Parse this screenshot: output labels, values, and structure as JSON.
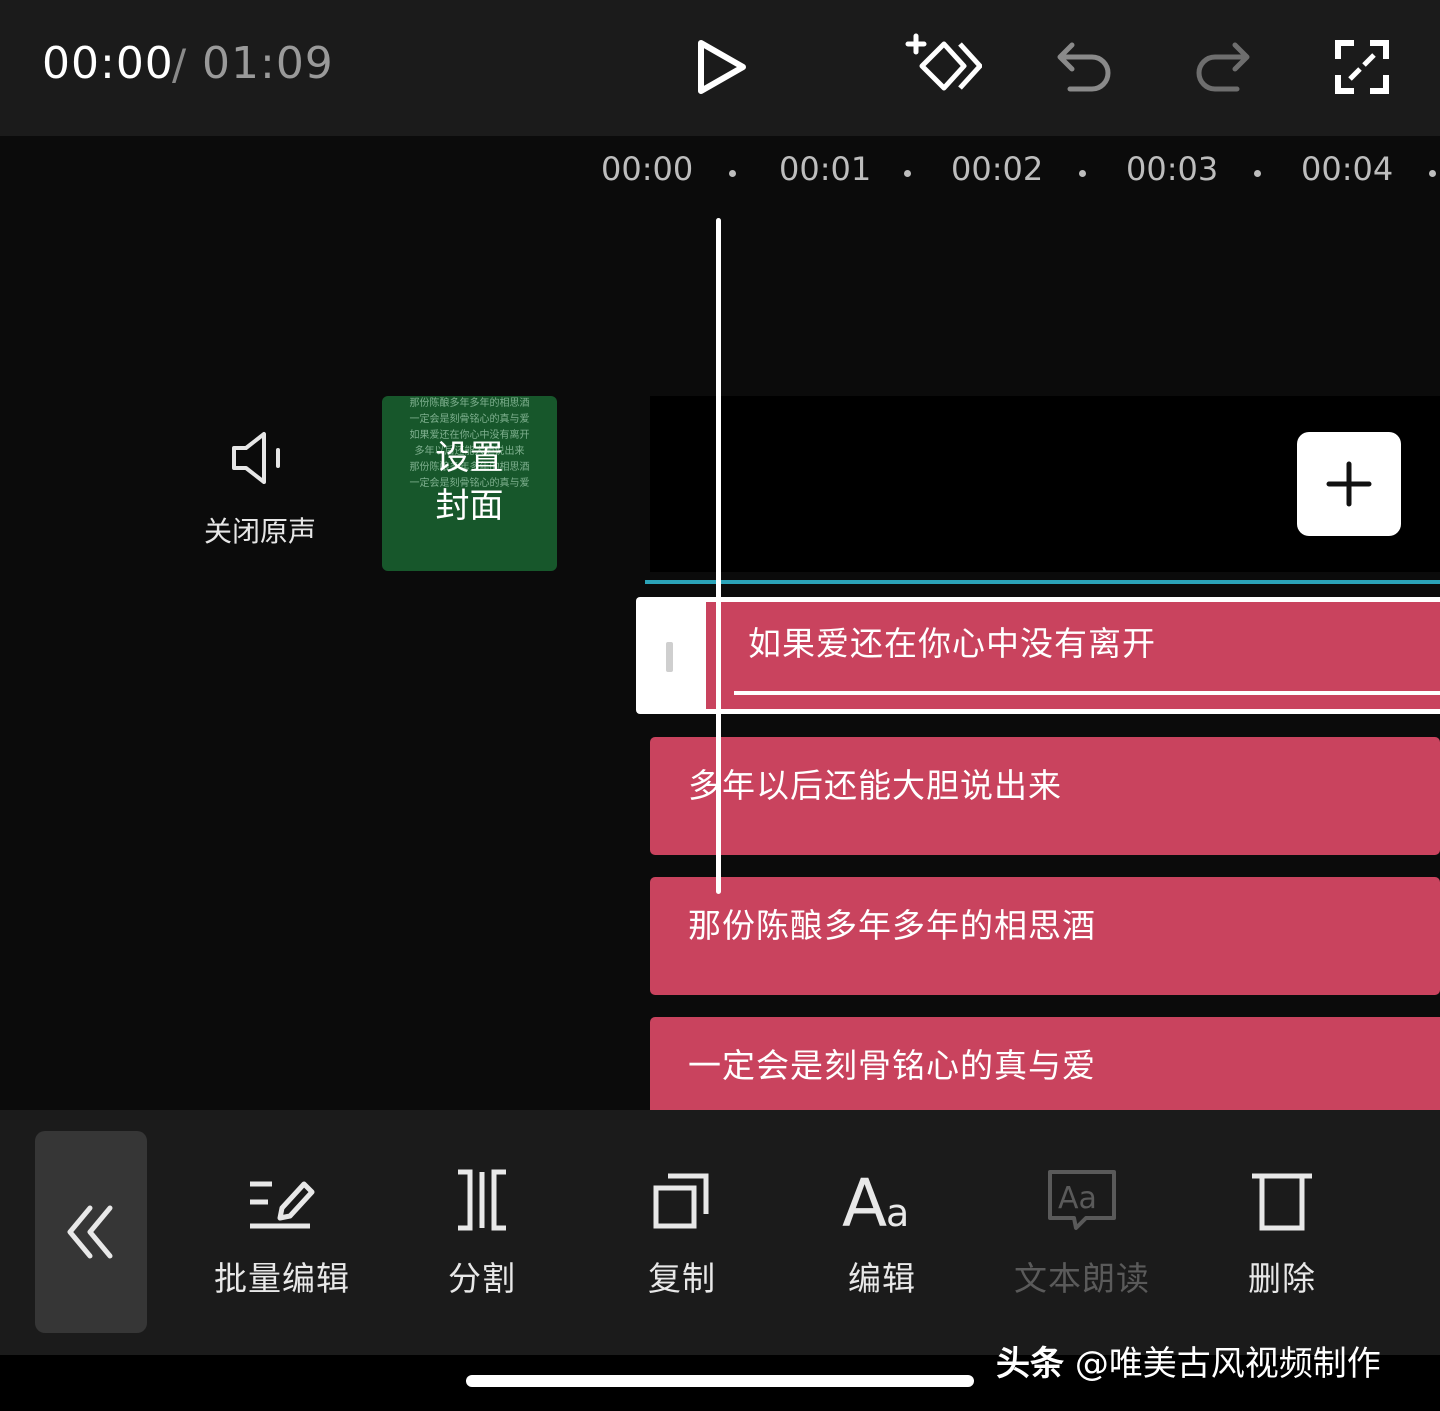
{
  "topbar": {
    "time_current": "00:00",
    "time_separator": "/",
    "time_total": "01:09",
    "icons": [
      "play-icon",
      "keyframe-add-icon",
      "undo-icon",
      "redo-icon",
      "fullscreen-icon"
    ]
  },
  "ruler": {
    "ticks": [
      "00:00",
      "00:01",
      "00:02",
      "00:03",
      "00:04"
    ]
  },
  "left_panel": {
    "mute_label": "关闭原声",
    "cover_label_line1": "设置",
    "cover_label_line2": "封面",
    "cover_thumbnail_lines": [
      "那份陈酿多年多年的相思酒",
      "一定会是刻骨铭心的真与爱",
      "如果爱还在你心中没有离开",
      "多年以后还能大胆说出来",
      "那份陈酿多年多年的相思酒",
      "一定会是刻骨铭心的真与爱"
    ]
  },
  "subtitles": {
    "selected": "如果爱还在你心中没有离开",
    "clips": [
      "多年以后还能大胆说出来",
      "那份陈酿多年多年的相思酒",
      "一定会是刻骨铭心的真与爱"
    ]
  },
  "toolbar": {
    "back_icon": "double-chevron-left-icon",
    "items": [
      {
        "label": "批量编辑",
        "icon": "batch-edit-icon",
        "enabled": true
      },
      {
        "label": "分割",
        "icon": "split-icon",
        "enabled": true
      },
      {
        "label": "复制",
        "icon": "copy-icon",
        "enabled": true
      },
      {
        "label": "编辑",
        "icon": "text-style-icon",
        "enabled": true
      },
      {
        "label": "文本朗读",
        "icon": "text-to-speech-icon",
        "enabled": false
      },
      {
        "label": "删除",
        "icon": "delete-icon",
        "enabled": true
      }
    ]
  },
  "watermark": {
    "brand": "头条",
    "handle": "@唯美古风视频制作"
  },
  "colors": {
    "clip": "#c9435e",
    "cover": "#17572b",
    "accent_line": "#2ba3b8",
    "background": "#0b0b0b",
    "bar": "#1b1b1b"
  }
}
